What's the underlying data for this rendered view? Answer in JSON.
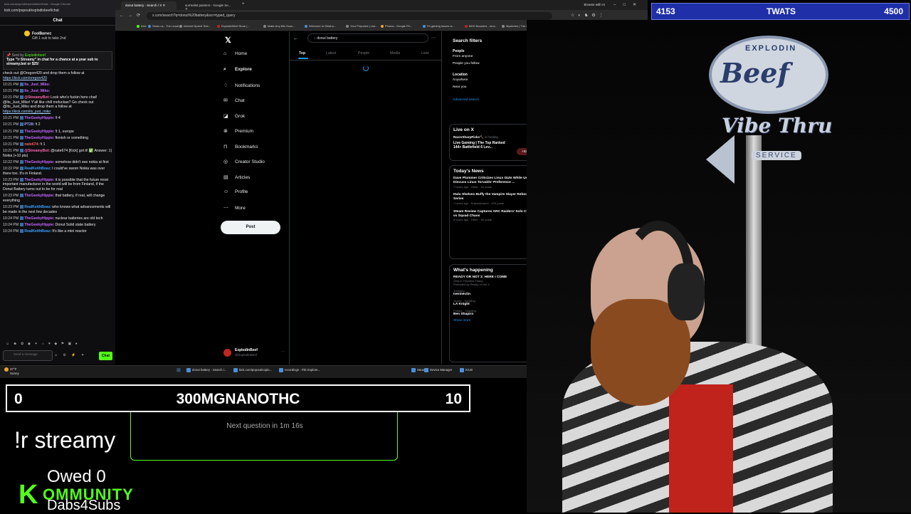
{
  "chat": {
    "window_title": "kick.com/popout/explodinbeef/chat - Google Chrome",
    "url": "kick.com/popout/explodinbeef/chat",
    "header": "Chat",
    "gift_user": "FoolBarnez",
    "gift_text": "Gift 1 sub to take 2nd",
    "pinned_by": "Explodinbeef",
    "pinned_text": "Type \"!r Streamy\" in chat for a chance at a year sub to streamy.bot or $25!",
    "messages": [
      {
        "time": "",
        "user": "",
        "color": "#ffffff",
        "text": "check out @Oregon420 and drop them a follow at",
        "link": "https://kick.com/oregon420"
      },
      {
        "time": "10:21 PM",
        "user": "Its_Just_Miko:",
        "color": "#c566ff",
        "text": "",
        "link": ""
      },
      {
        "time": "10:21 PM",
        "user": "Its_Just_Miko:",
        "color": "#c566ff",
        "text": "",
        "link": ""
      },
      {
        "time": "10:21 PM",
        "user": "@StreamyBot:",
        "color": "#ff69b4",
        "text": "Look who's fuckin here chat! @Its_Just_Miko! Y'all like chill mofuckas? Go check out @Its_Just_Miko and drop them a follow at",
        "link": "https://kick.com/its_just_miko"
      },
      {
        "time": "10:21 PM",
        "user": "TheGeekyHippie:",
        "color": "#c566ff",
        "text": "!t 4",
        "link": ""
      },
      {
        "time": "10:21 PM",
        "user": "PT28:",
        "color": "#9fa8ff",
        "text": "!t 2",
        "link": ""
      },
      {
        "time": "10:21 PM",
        "user": "TheGeekyHippie:",
        "color": "#c566ff",
        "text": "!t 1, europe",
        "link": ""
      },
      {
        "time": "10:21 PM",
        "user": "TheGeekyHippie:",
        "color": "#c566ff",
        "text": "finnish or something",
        "link": ""
      },
      {
        "time": "10:21 PM",
        "user": "nate674:",
        "color": "#ff5c5c",
        "text": "!t 1",
        "link": ""
      },
      {
        "time": "10:21 PM",
        "user": "@StreamyBot:",
        "color": "#ff69b4",
        "text": "@nate674 [Kick] got it! ✅ Answer: 1) Nokia (+10 pts)",
        "link": ""
      },
      {
        "time": "10:22 PM",
        "user": "TheGeekyHippie:",
        "color": "#c566ff",
        "text": "somehow didn't see nokia at first",
        "link": ""
      },
      {
        "time": "10:22 PM",
        "user": "RealKeithBoaz:",
        "color": "#3aa0ff",
        "text": "I could've sworn Nokia was over there too. It's in Finland.",
        "link": ""
      },
      {
        "time": "10:23 PM",
        "user": "TheGeekyHippie:",
        "color": "#c566ff",
        "text": "it is possible that the future most important manufacturer in the world will be from Finland, if the Donut Battery turns out to be for real",
        "link": ""
      },
      {
        "time": "10:23 PM",
        "user": "TheGeekyHippie:",
        "color": "#c566ff",
        "text": "that battery, if real, will change everything",
        "link": ""
      },
      {
        "time": "10:23 PM",
        "user": "RealKeithBoaz:",
        "color": "#3aa0ff",
        "text": "who knows what advancements will be made in the next few decades",
        "link": ""
      },
      {
        "time": "10:24 PM",
        "user": "TheGeekyHippie:",
        "color": "#c566ff",
        "text": "nuclear batteries are old tech",
        "link": ""
      },
      {
        "time": "10:24 PM",
        "user": "TheGeekyHippie:",
        "color": "#c566ff",
        "text": "Donut Solid state battery",
        "link": ""
      },
      {
        "time": "10:24 PM",
        "user": "RealKeithBoaz:",
        "color": "#3aa0ff",
        "text": "It's like a mini reactor",
        "link": ""
      }
    ],
    "input_placeholder": "Send a message",
    "send_label": "Chat"
  },
  "browser": {
    "tabs": [
      {
        "label": "donut battery - Search / X",
        "active": true
      },
      {
        "label": "surrealist painters - Google Se...",
        "active": false
      }
    ],
    "browse_ai": "Browse with AI",
    "url": "x.com/search?q=donut%20battery&src=typed_query",
    "bookmarks": [
      {
        "label": "Kick",
        "color": "#53fc18"
      },
      {
        "label": "Stoku.us - The Leadi...",
        "color": "#4a90d9"
      },
      {
        "label": "Internet Speed Test...",
        "color": "#888888"
      },
      {
        "label": "ExplodinBeef Store |...",
        "color": "#c0261f"
      },
      {
        "label": "Make Any Mic Soun...",
        "color": "#888888"
      },
      {
        "label": "Welcome to Oklaho...",
        "color": "#4a90d9"
      },
      {
        "label": "Your Prepolice | clot...",
        "color": "#888888"
      },
      {
        "label": "Photos - Google Ph...",
        "color": "#f0a030"
      },
      {
        "label": "Fb gaming issues w...",
        "color": "#4a90d9"
      },
      {
        "label": "BOX Boosters - mov...",
        "color": "#c0261f"
      },
      {
        "label": "Mysteries | The lat...",
        "color": "#888888"
      },
      {
        "label": "Andreas - gamer -...",
        "color": "#888888"
      }
    ],
    "all_bookmarks": "All Bookmarks"
  },
  "x": {
    "nav": [
      {
        "label": "Home",
        "icon": "⌂",
        "bold": false
      },
      {
        "label": "Explore",
        "icon": "⌕",
        "bold": true
      },
      {
        "label": "Notifications",
        "icon": "♢",
        "bold": false
      },
      {
        "label": "Chat",
        "icon": "✉",
        "bold": false
      },
      {
        "label": "Grok",
        "icon": "◪",
        "bold": false
      },
      {
        "label": "Premium",
        "icon": "⊗",
        "bold": false
      },
      {
        "label": "Bookmarks",
        "icon": "⊓",
        "bold": false
      },
      {
        "label": "Creator Studio",
        "icon": "◎",
        "bold": false
      },
      {
        "label": "Articles",
        "icon": "▤",
        "bold": false
      },
      {
        "label": "Profile",
        "icon": "☺",
        "bold": false
      },
      {
        "label": "More",
        "icon": "⋯",
        "bold": false
      }
    ],
    "post_label": "Post",
    "profile_name": "ExplodinBeef",
    "profile_handle": "@ExplodinBeef",
    "search_value": "donut battery",
    "tabs": [
      "Top",
      "Latest",
      "People",
      "Media",
      "Lists"
    ],
    "filters": {
      "title": "Search filters",
      "people_label": "People",
      "people_options": [
        "From anyone",
        "People you follow"
      ],
      "location_label": "Location",
      "location_options": [
        "Anywhere",
        "Near you"
      ],
      "advanced": "Advanced search"
    },
    "live": {
      "title": "Live on X",
      "host": "RacerSharpPicks🔨",
      "host_status": "is hosting",
      "text": "Live Gaming | The Top Ranked 144+ Battlefield 6 Lev...",
      "count": "+53"
    },
    "news": {
      "title": "Today's News",
      "items": [
        {
          "headline": "Dave Plummer Criticizes Linux GUIs While Users Discuss Linus Torvalds' Preference ...",
          "meta": "7 hours ago · Other · 1K posts"
        },
        {
          "headline": "Hulu Shelves Buffy the Vampire Slayer Reboot Series",
          "meta": "7 hours ago · Entertainment · 12K posts"
        },
        {
          "headline": "Steam Review Captures ARC Raiders' Solo Chill vs Squad Chaos",
          "meta": "8 hours ago · Other · 3K posts"
        }
      ]
    },
    "happening": {
      "title": "What's happening",
      "items": [
        {
          "category": "",
          "name": "READY OR NOT 2: HERE I COME",
          "sub": "Only in Theaters Friday",
          "promo": "Promoted by Ready or Not 2"
        },
        {
          "category": "Trending",
          "name": "Ivermectin",
          "sub": "",
          "promo": ""
        },
        {
          "category": "Sports · Trending",
          "name": "LA Knight",
          "sub": "",
          "promo": ""
        },
        {
          "category": "Politics · Trending",
          "name": "Ben Shapiro",
          "sub": "",
          "promo": ""
        }
      ],
      "show_more": "Show more"
    }
  },
  "taskbar": {
    "weather_temp": "37°F",
    "weather_desc": "Sunny",
    "items": [
      "donut battery - Search /...",
      "kick.com/popout/explo...",
      "recordings - File Explore...",
      "Steam",
      "Device Manager",
      "ICUE"
    ]
  },
  "overlay": {
    "top_score_left": "4153",
    "top_score_title": "TWATS",
    "top_score_right": "4500",
    "sign_top": "EXPLODIN",
    "sign_brand": "Beef",
    "sign_vibe": "Vibe Thru",
    "sign_service": "SERVICE",
    "bottom_score_left": "0",
    "bottom_score_title": "300MGNANOTHC",
    "bottom_score_right": "10",
    "next_question": "Next question in 1m 16s",
    "command": "!r streamy",
    "owed": "Owed 0",
    "kommunity_k": "K",
    "kommunity_rest": "OMMUNITY",
    "dabs": "Dabs4Subs"
  }
}
